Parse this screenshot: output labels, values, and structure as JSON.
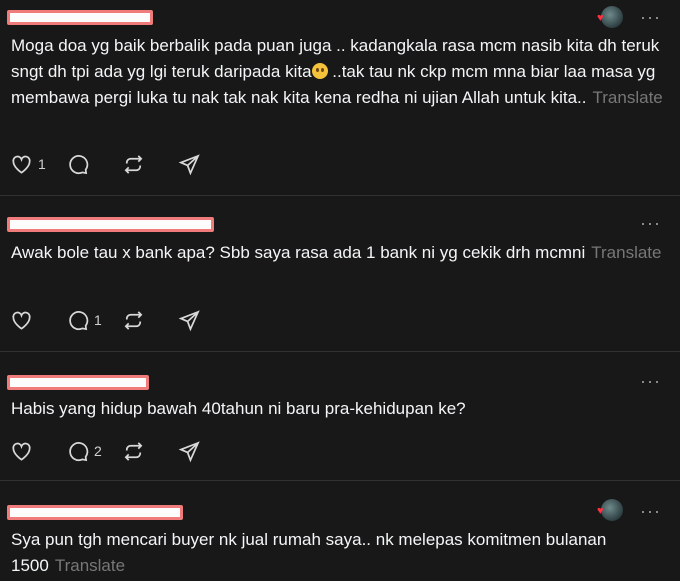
{
  "posts": [
    {
      "body_before_emoji": "Moga doa yg baik berbalik pada puan juga .. kadangkala rasa mcm nasib kita dh teruk sngt dh tpi ada yg lgi teruk daripada kita",
      "body_after_emoji": " ..tak tau nk ckp mcm mna biar laa masa yg membawa pergi luka tu nak tak nak kita kena redha ni ujian Allah untuk kita..",
      "translate": "Translate",
      "like_count": "1",
      "reply_count": ""
    },
    {
      "body": "Awak bole tau x bank apa? Sbb saya rasa ada 1 bank ni yg cekik drh mcmni",
      "translate": "Translate",
      "like_count": "",
      "reply_count": "1"
    },
    {
      "body": "Habis yang hidup bawah 40tahun ni baru pra-kehidupan ke?",
      "translate": "",
      "like_count": "",
      "reply_count": "2"
    },
    {
      "body": "Sya pun tgh mencari buyer nk jual rumah saya.. nk melepas komitmen bulanan 1500",
      "translate": "Translate",
      "like_count": "",
      "reply_count": ""
    }
  ],
  "more_glyph": "···",
  "heart_glyph": "♥"
}
